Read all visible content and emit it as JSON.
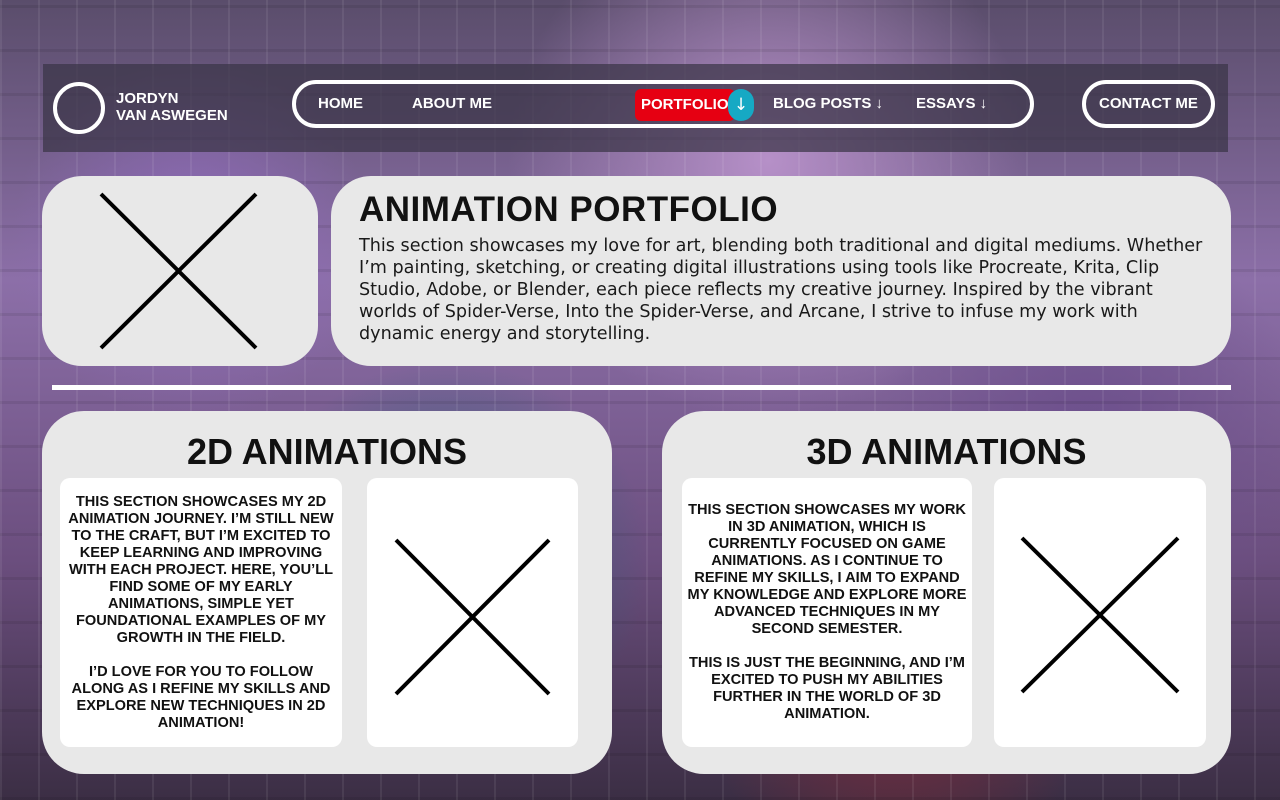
{
  "nav": {
    "brand_line1": "JORDYN",
    "brand_line2": "VAN ASWEGEN",
    "home": "HOME",
    "about": "ABOUT ME",
    "portfolio": "PORTFOLIO",
    "portfolio_arrow": "↓",
    "blog": "BLOG POSTS",
    "blog_arrow": "↓",
    "essays": "ESSAYS",
    "essays_arrow": "↓",
    "contact": "CONTACT ME"
  },
  "intro": {
    "title": "ANIMATION PORTFOLIO",
    "body": "This section showcases my love for art, blending both traditional and digital mediums. Whether I’m painting, sketching, or creating digital illustrations using tools like Procreate, Krita, Clip Studio, Adobe, or Blender, each piece reflects my creative journey. Inspired by the vibrant worlds of Spider-Verse, Into the Spider-Verse, and Arcane, I strive to infuse my work with dynamic energy and storytelling."
  },
  "section_2d": {
    "title": "2D ANIMATIONS",
    "para1": "THIS SECTION SHOWCASES MY 2D ANIMATION JOURNEY. I’M STILL NEW TO THE CRAFT, BUT I’M EXCITED TO KEEP LEARNING AND IMPROVING WITH EACH PROJECT. HERE, YOU’LL FIND SOME OF MY EARLY ANIMATIONS, SIMPLE YET FOUNDATIONAL EXAMPLES OF MY GROWTH IN THE FIELD.",
    "para2": "I’D LOVE FOR YOU TO FOLLOW ALONG AS I REFINE MY SKILLS AND EXPLORE NEW TECHNIQUES IN 2D ANIMATION!"
  },
  "section_3d": {
    "title": "3D ANIMATIONS",
    "para1": "THIS SECTION SHOWCASES MY WORK IN 3D ANIMATION, WHICH IS CURRENTLY FOCUSED ON GAME ANIMATIONS. AS I CONTINUE TO REFINE MY SKILLS, I AIM TO EXPAND MY KNOWLEDGE AND EXPLORE MORE ADVANCED TECHNIQUES IN MY SECOND SEMESTER.",
    "para2": "THIS IS JUST THE BEGINNING, AND I’M EXCITED TO PUSH MY ABILITIES FURTHER IN THE WORLD OF 3D ANIMATION."
  },
  "colors": {
    "active_nav": "#e60012",
    "arrow_bubble": "#16a9c4",
    "card_bg": "#e8e8e8"
  },
  "icons": {
    "placeholder": "x-placeholder-icon",
    "dropdown": "arrow-down-icon"
  }
}
